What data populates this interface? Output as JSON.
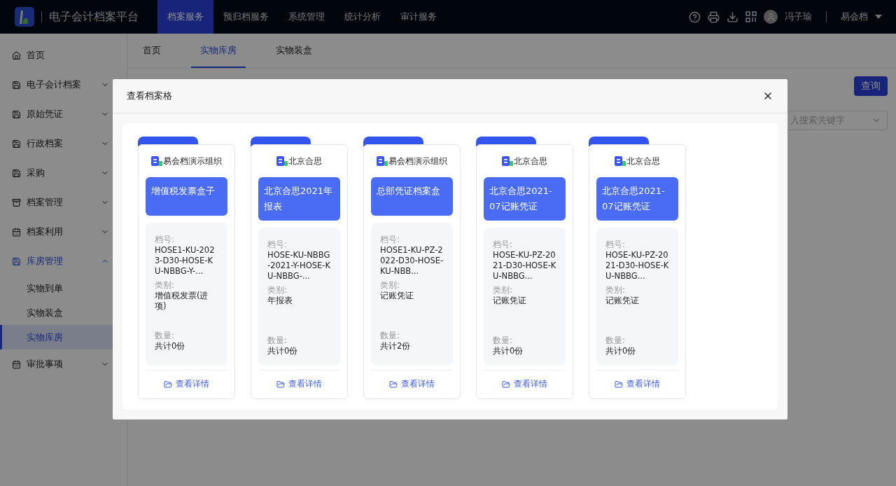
{
  "topbar": {
    "title": "电子会计档案平台",
    "nav": [
      {
        "label": "档案服务",
        "selected": true
      },
      {
        "label": "预归档服务",
        "selected": false
      },
      {
        "label": "系统管理",
        "selected": false
      },
      {
        "label": "统计分析",
        "selected": false
      },
      {
        "label": "审计服务",
        "selected": false
      }
    ],
    "user": {
      "name": "冯子瑜",
      "org": "易会档"
    }
  },
  "sidebar": {
    "items": [
      {
        "label": "首页"
      },
      {
        "label": "电子会计档案",
        "expanded": false
      },
      {
        "label": "原始凭证",
        "expanded": false
      },
      {
        "label": "行政档案",
        "expanded": false
      },
      {
        "label": "采购",
        "expanded": false
      },
      {
        "label": "档案管理",
        "expanded": false
      },
      {
        "label": "档案利用",
        "expanded": false
      },
      {
        "label": "库房管理",
        "expanded": true,
        "children": [
          {
            "label": "实物到单",
            "selected": false
          },
          {
            "label": "实物装盒",
            "selected": false
          },
          {
            "label": "实物库房",
            "selected": true
          }
        ]
      },
      {
        "label": "审批事项",
        "expanded": false
      }
    ]
  },
  "tabs": [
    {
      "label": "首页",
      "selected": false
    },
    {
      "label": "实物库房",
      "selected": true
    },
    {
      "label": "实物装盒",
      "selected": false
    }
  ],
  "toolbar": {
    "query_button": "查询",
    "search_select": {
      "placeholder": "入搜索关键字"
    }
  },
  "modal": {
    "title": "查看档案格",
    "cards": [
      {
        "org": "易会档演示组织",
        "title": "增值税发票盒子",
        "fields": [
          {
            "label": "档号:",
            "value": "HOSE1-KU-2023-D30-HOSE-KU-NBBG-Y-..."
          },
          {
            "label": "类别:",
            "value": "增值税发票(进项)"
          },
          {
            "label": "数量:",
            "value": "共计0份"
          }
        ],
        "link": "查看详情"
      },
      {
        "org": "北京合思",
        "title": "北京合思2021年报表",
        "fields": [
          {
            "label": "档号:",
            "value": "HOSE-KU-NBBG-2021-Y-HOSE-KU-NBBG-..."
          },
          {
            "label": "类别:",
            "value": "年报表"
          },
          {
            "label": "数量:",
            "value": "共计0份"
          }
        ],
        "link": "查看详情"
      },
      {
        "org": "易会档演示组织",
        "title": "总部凭证档案盒",
        "fields": [
          {
            "label": "档号:",
            "value": "HOSE1-KU-PZ-2022-D30-HOSE-KU-NBB..."
          },
          {
            "label": "类别:",
            "value": "记账凭证"
          },
          {
            "label": "数量:",
            "value": "共计2份"
          }
        ],
        "link": "查看详情"
      },
      {
        "org": "北京合思",
        "title": "北京合思2021-07记账凭证",
        "fields": [
          {
            "label": "档号:",
            "value": "HOSE-KU-PZ-2021-D30-HOSE-KU-NBBG..."
          },
          {
            "label": "类别:",
            "value": "记账凭证"
          },
          {
            "label": "数量:",
            "value": "共计0份"
          }
        ],
        "link": "查看详情"
      },
      {
        "org": "北京合思",
        "title": "北京合思2021-07记账凭证",
        "fields": [
          {
            "label": "档号:",
            "value": "HOSE-KU-PZ-2021-D30-HOSE-KU-NBBG..."
          },
          {
            "label": "类别:",
            "value": "记账凭证"
          },
          {
            "label": "数量:",
            "value": "共计0份"
          }
        ],
        "link": "查看详情"
      }
    ]
  }
}
